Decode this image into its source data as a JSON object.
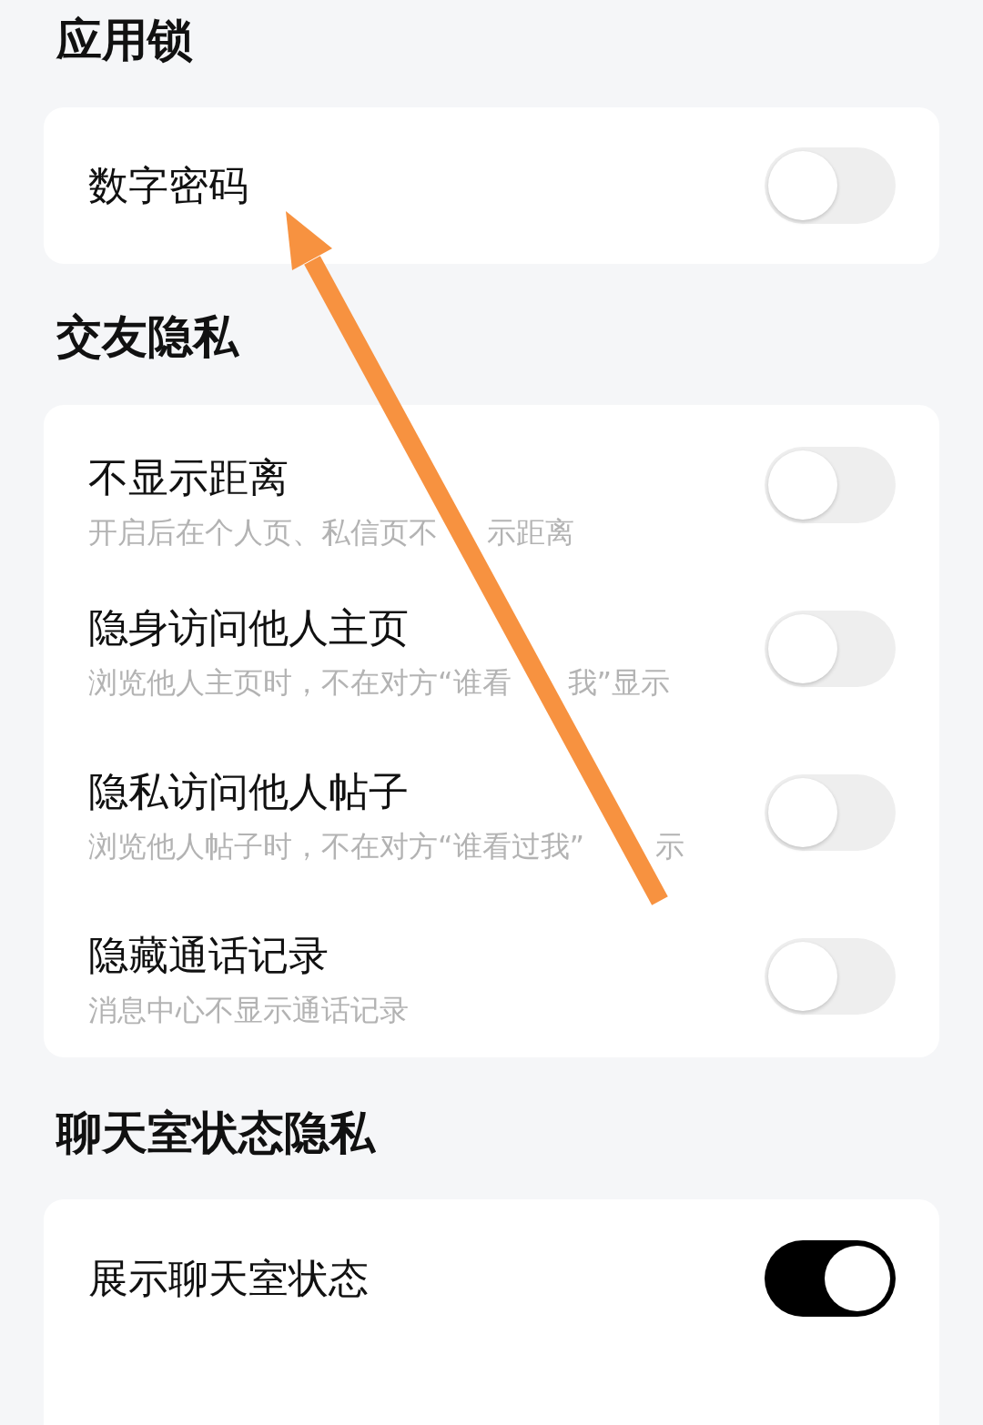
{
  "sections": [
    {
      "title": "应用锁",
      "rows": [
        {
          "label": "数字密码",
          "on": false
        }
      ]
    },
    {
      "title": "交友隐私",
      "rows": [
        {
          "label": "不显示距离",
          "description": [
            "开启后在个人页、私信页不",
            "示距离"
          ],
          "on": false
        },
        {
          "label": "隐身访问他人主页",
          "description": [
            "浏览他人主页时，不在对方“谁看",
            "我”显示"
          ],
          "on": false
        },
        {
          "label": "隐私访问他人帖子",
          "description": [
            "浏览他人帖子时，不在对方“谁看过我”",
            "示"
          ],
          "on": false
        },
        {
          "label": "隐藏通话记录",
          "description": [
            "消息中心不显示通话记录"
          ],
          "on": false
        }
      ]
    },
    {
      "title": "聊天室状态隐私",
      "rows": [
        {
          "label": "展示聊天室状态",
          "on": true
        }
      ]
    }
  ]
}
